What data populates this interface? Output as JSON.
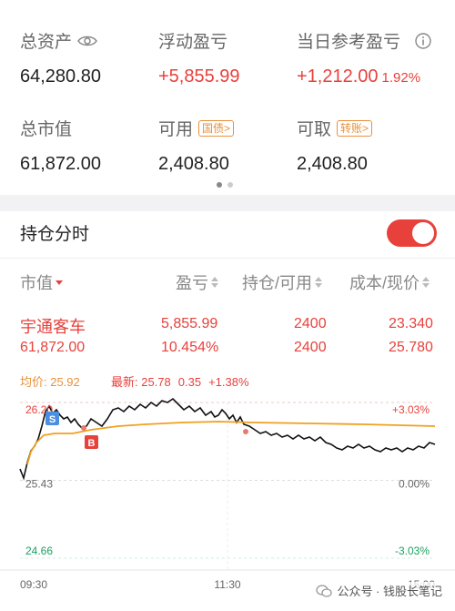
{
  "summary": {
    "total_assets": {
      "label": "总资产",
      "value": "64,280.80"
    },
    "floating_pl": {
      "label": "浮动盈亏",
      "value": "+5,855.99"
    },
    "today_pl": {
      "label": "当日参考盈亏",
      "value": "+1,212.00",
      "pct": "1.92%"
    },
    "market_value": {
      "label": "总市值",
      "value": "61,872.00"
    },
    "available": {
      "label": "可用",
      "tag": "国债>",
      "value": "2,408.80"
    },
    "withdrawable": {
      "label": "可取",
      "tag": "转账>",
      "value": "2,408.80"
    }
  },
  "pager": {
    "pages": 2,
    "active": 0
  },
  "holdings": {
    "title": "持仓分时",
    "toggle_on": true,
    "columns": [
      "市值",
      "盈亏",
      "持仓/可用",
      "成本/现价"
    ],
    "position": {
      "name": "宇通客车",
      "market_value": "61,872.00",
      "pl": "5,855.99",
      "pl_pct": "10.454%",
      "hold": "2400",
      "available": "2400",
      "cost": "23.340",
      "price": "25.780"
    }
  },
  "chart_legend": {
    "avg_label": "均价: 25.92",
    "latest_label": "最新: 25.78",
    "change": "0.35",
    "change_pct": "+1.38%"
  },
  "chart_data": {
    "type": "line",
    "y_ticks": [
      "26.20",
      "25.43",
      "24.66"
    ],
    "y_pct_ticks": [
      "+3.03%",
      "0.00%",
      "-3.03%"
    ],
    "x_ticks": [
      "09:30",
      "11:30",
      "15:00"
    ],
    "ylim": [
      24.66,
      26.2
    ],
    "markers": [
      {
        "label": "S",
        "color": "#4a8fe0"
      },
      {
        "label": "B",
        "color": "#e8413b"
      }
    ],
    "colors": {
      "price": "#111111",
      "avg": "#f0a020",
      "up": "#e8413b",
      "down": "#1aa260"
    }
  },
  "watermark": {
    "text": "公众号 · 钱股长笔记"
  }
}
